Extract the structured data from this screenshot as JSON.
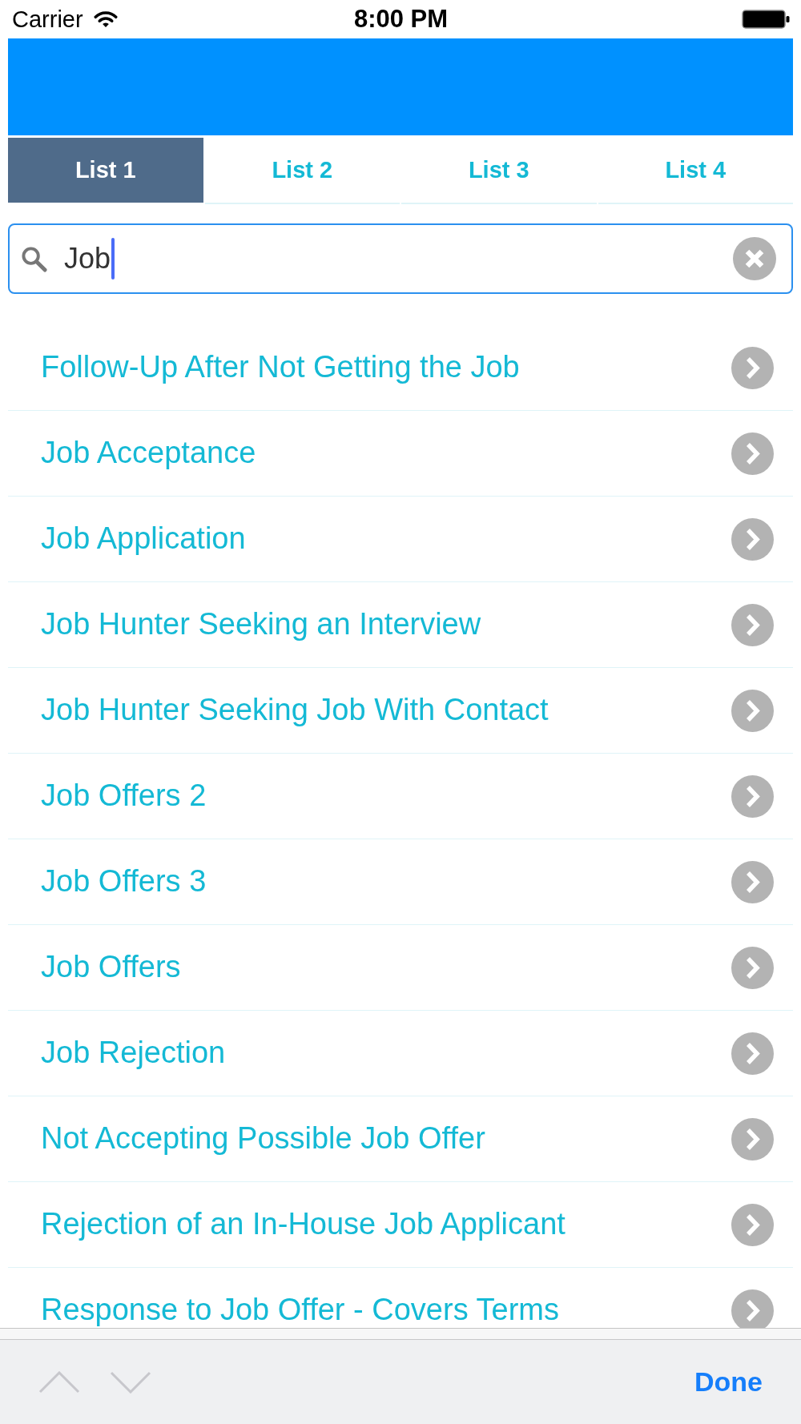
{
  "status_bar": {
    "carrier": "Carrier",
    "time": "8:00 PM"
  },
  "tabs": [
    {
      "label": "List 1",
      "selected": true
    },
    {
      "label": "List 2",
      "selected": false
    },
    {
      "label": "List 3",
      "selected": false
    },
    {
      "label": "List 4",
      "selected": false
    }
  ],
  "search": {
    "value": "Job"
  },
  "results": [
    "Follow-Up After Not Getting the Job",
    "Job Acceptance",
    "Job Application",
    "Job Hunter Seeking an Interview",
    "Job Hunter Seeking Job With Contact",
    "Job Offers 2",
    "Job Offers 3",
    "Job Offers",
    "Job Rejection",
    "Not Accepting Possible Job Offer",
    "Rejection of an In-House Job Applicant",
    "Response to Job Offer - Covers Terms"
  ],
  "toolbar": {
    "nav_buttons": [
      {
        "kind": "previous",
        "disabled": true
      },
      {
        "kind": "next",
        "disabled": true
      }
    ],
    "done": "Done"
  }
}
